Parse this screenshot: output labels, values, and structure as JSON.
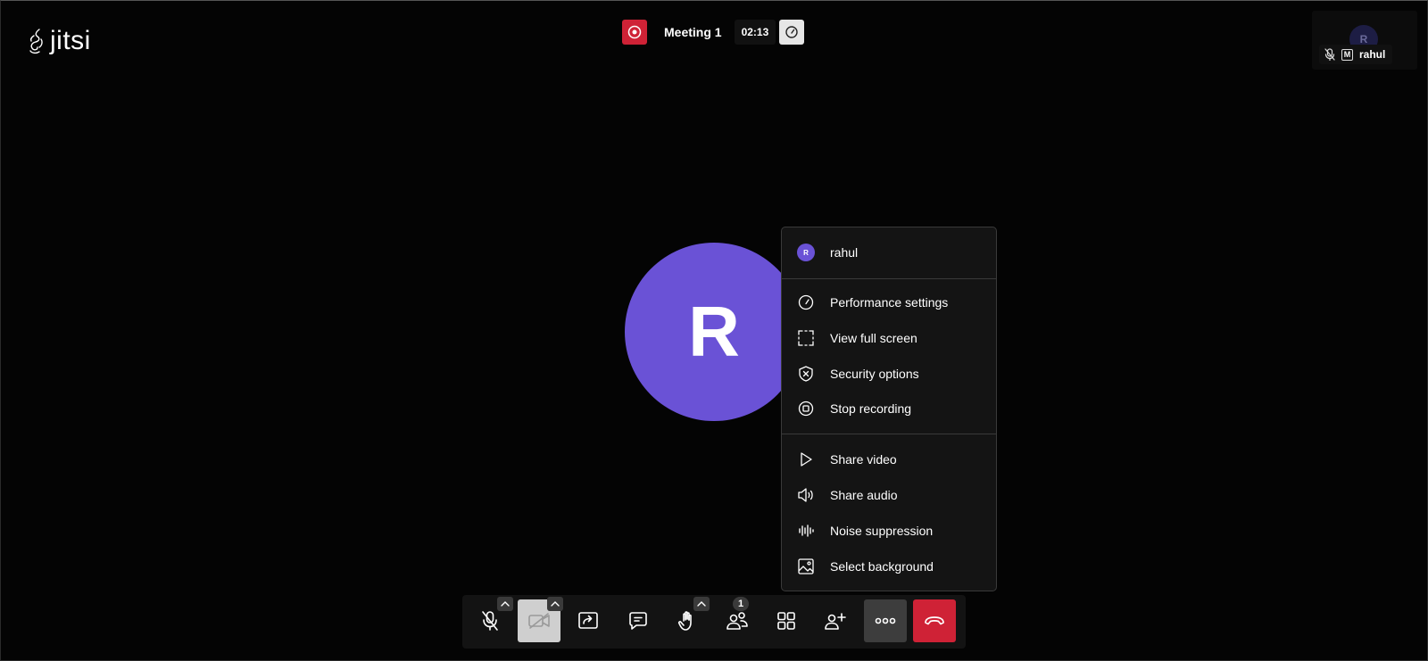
{
  "app": {
    "logo_text": "jitsi"
  },
  "header": {
    "meeting_title": "Meeting 1",
    "timer": "02:13",
    "recording_icon": "record-icon",
    "performance_icon": "speedometer-icon"
  },
  "thumbnail": {
    "avatar_initial": "R",
    "moderator_badge": "M",
    "name": "rahul"
  },
  "stage": {
    "avatar_initial": "R",
    "avatar_color": "#6a52d6"
  },
  "menu": {
    "user": {
      "initial": "R",
      "name": "rahul"
    },
    "items": [
      {
        "label": "Performance settings",
        "icon": "speedometer-icon"
      },
      {
        "label": "View full screen",
        "icon": "fullscreen-icon"
      },
      {
        "label": "Security options",
        "icon": "shield-icon"
      },
      {
        "label": "Stop recording",
        "icon": "stop-recording-icon"
      },
      {
        "label": "Share video",
        "icon": "play-icon"
      },
      {
        "label": "Share audio",
        "icon": "speaker-icon"
      },
      {
        "label": "Noise suppression",
        "icon": "waveform-icon"
      },
      {
        "label": "Select background",
        "icon": "image-icon"
      }
    ]
  },
  "toolbar": {
    "participants_count": "1",
    "buttons": [
      "microphone-muted-icon",
      "camera-off-icon",
      "screen-share-icon",
      "chat-icon",
      "raise-hand-icon",
      "participants-icon",
      "tile-view-icon",
      "invite-icon",
      "more-icon",
      "hangup-icon"
    ]
  },
  "colors": {
    "background": "#040404",
    "recording_red": "#cf2236",
    "hangup_red": "#cf2236",
    "avatar_purple": "#6a52d6"
  }
}
